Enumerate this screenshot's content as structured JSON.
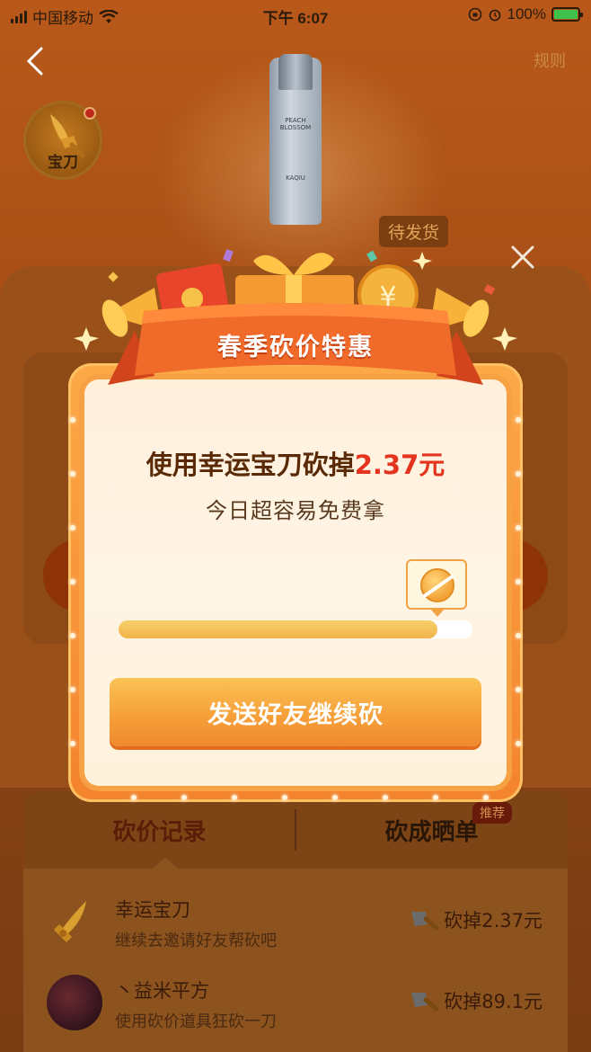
{
  "status_bar": {
    "carrier": "中国移动",
    "time": "下午 6:07",
    "battery_pct": "100%"
  },
  "nav": {
    "rules_label": "规则"
  },
  "background": {
    "blade_badge_label": "宝刀",
    "product_label": "PEACH BLOSSOM",
    "product_brand": "KAQIU",
    "pending_tag": "待发货",
    "tabs": {
      "records": "砍价记录",
      "done": "砍成晒单",
      "recommend_tag": "推荐"
    },
    "records": [
      {
        "name": "幸运宝刀",
        "desc": "继续去邀请好友帮砍吧",
        "amount": "砍掉2.37元"
      },
      {
        "name": "丶益米平方",
        "desc": "使用砍价道具狂砍一刀",
        "amount": "砍掉89.1元"
      }
    ]
  },
  "modal": {
    "banner_title": "春季砍价特惠",
    "headline_prefix": "使用幸运宝刀砍掉",
    "headline_amount": "2.37元",
    "subline": "今日超容易免费拿",
    "progress_fraction": 0.9,
    "cta_label": "发送好友继续砍"
  },
  "colors": {
    "accent_red": "#e4341e",
    "cta_orange": "#f6a03a",
    "frame_orange": "#f4832d"
  }
}
